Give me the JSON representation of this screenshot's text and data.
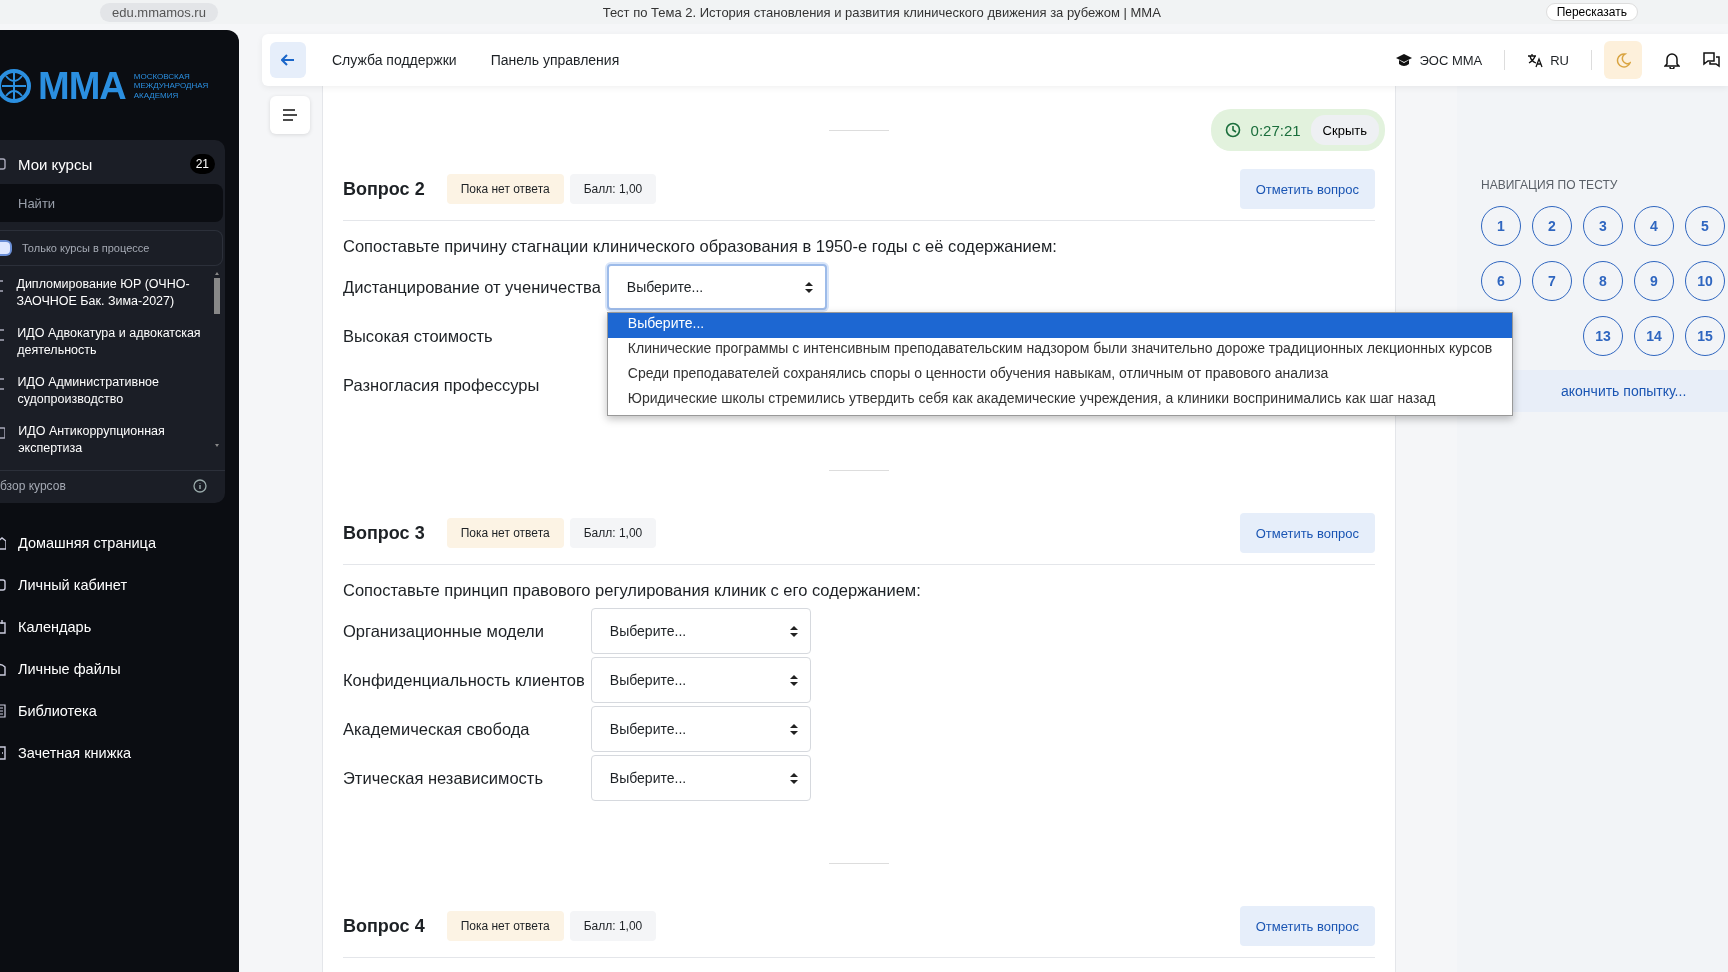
{
  "browser": {
    "url": "edu.mmamos.ru",
    "title": "Тест по Тема 2. История становления и развития клинического движения за рубежом | ММА",
    "action": "Пересказать"
  },
  "sidebar": {
    "logo": {
      "name": "ММА",
      "subtitle": "МОСКОВСКАЯ МЕЖДУНАРОДНАЯ АКАДЕМИЯ"
    },
    "courses": {
      "title": "Мои курсы",
      "count": "21",
      "search_placeholder": "Найти",
      "filter": {
        "label": "Только курсы в процессе",
        "on": true
      },
      "items": [
        {
          "name": "Дипломирование ЮР (ОЧНО-ЗАОЧНОЕ Бак. Зима-2027)"
        },
        {
          "name": "ИДО Адвокатура и адвокатская деятельность"
        },
        {
          "name": "ИДО Административное судопроизводство"
        },
        {
          "name": "ИДО Антикоррупционная экспертиза"
        }
      ],
      "footer": "бзор курсов"
    },
    "nav": [
      {
        "label": "Домашняя страница",
        "kind": "home"
      },
      {
        "label": "Личный кабинет",
        "kind": "profile"
      },
      {
        "label": "Календарь",
        "kind": "calendar"
      },
      {
        "label": "Личные файлы",
        "kind": "files"
      },
      {
        "label": "Библиотека",
        "kind": "library"
      },
      {
        "label": "Зачетная книжка",
        "kind": "gradebook"
      }
    ]
  },
  "header": {
    "links": [
      "Служба поддержки",
      "Панель управления"
    ],
    "portal": "ЭОС ММА",
    "language": "RU"
  },
  "timer": {
    "time": "0:27:21",
    "hide": "Скрыть"
  },
  "questions": [
    {
      "title": "Вопрос 2",
      "status": "Пока нет ответа",
      "score": "Балл: 1,00",
      "flag": "Отметить вопрос",
      "prompt": "Сопоставьте причину стагнации клинического образования в 1950-е годы с её содержанием:",
      "rows": [
        {
          "label": "Дистанцирование от ученичества",
          "value": "Выберите...",
          "open": true,
          "options": [
            {
              "text": "Выберите...",
              "selected": true
            },
            {
              "text": "Клинические программы с интенсивным преподавательским надзором были значительно дороже традиционных лекционных курсов",
              "selected": false
            },
            {
              "text": "Среди преподавателей сохранялись споры о ценности обучения навыкам, отличным от правового анализа",
              "selected": false
            },
            {
              "text": "Юридические школы стремились утвердить себя как академические учреждения, а клиники воспринимались как шаг назад",
              "selected": false
            }
          ]
        },
        {
          "label": "Высокая стоимость"
        },
        {
          "label": "Разногласия профессуры"
        }
      ]
    },
    {
      "title": "Вопрос 3",
      "status": "Пока нет ответа",
      "score": "Балл: 1,00",
      "flag": "Отметить вопрос",
      "prompt": "Сопоставьте принцип правового регулирования клиник с его содержанием:",
      "rows": [
        {
          "label": "Организационные модели",
          "value": "Выберите...",
          "open": false
        },
        {
          "label": "Конфиденциальность клиентов",
          "value": "Выберите...",
          "open": false
        },
        {
          "label": "Академическая свобода",
          "value": "Выберите...",
          "open": false
        },
        {
          "label": "Этическая независимость",
          "value": "Выберите...",
          "open": false
        }
      ]
    },
    {
      "title": "Вопрос 4",
      "status": "Пока нет ответа",
      "score": "Балл: 1,00",
      "flag": "Отметить вопрос"
    }
  ],
  "quiz_nav": {
    "title": "НАВИГАЦИЯ ПО ТЕСТУ",
    "items": [
      {
        "label": "1"
      },
      {
        "label": "2"
      },
      {
        "label": "3"
      },
      {
        "label": "4"
      },
      {
        "label": "5"
      },
      {
        "label": "6"
      },
      {
        "label": "7"
      },
      {
        "label": "8"
      },
      {
        "label": "9"
      },
      {
        "label": "10"
      },
      {
        "label": "13"
      },
      {
        "label": "14"
      },
      {
        "label": "15"
      }
    ],
    "finish": "акончить попытку..."
  }
}
